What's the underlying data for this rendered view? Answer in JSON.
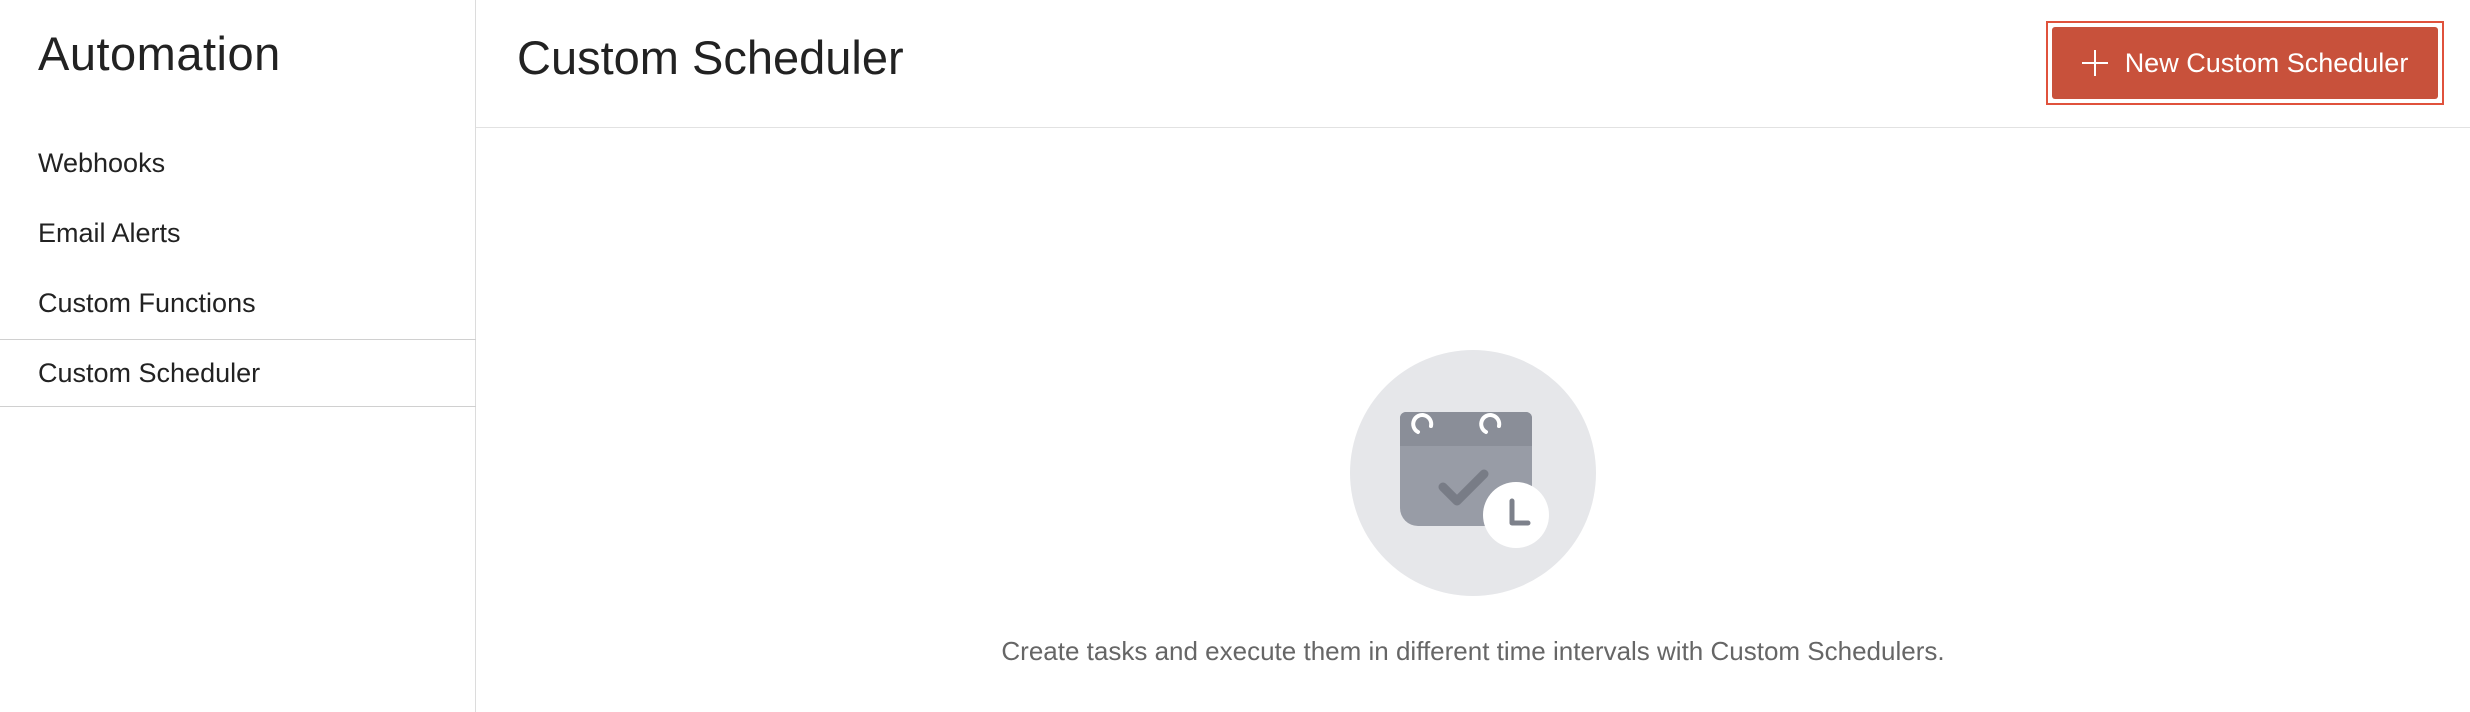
{
  "sidebar": {
    "title": "Automation",
    "items": [
      {
        "label": "Webhooks",
        "active": false
      },
      {
        "label": "Email Alerts",
        "active": false
      },
      {
        "label": "Custom Functions",
        "active": false
      },
      {
        "label": "Custom Scheduler",
        "active": true
      }
    ]
  },
  "header": {
    "title": "Custom Scheduler",
    "new_button_label": "New Custom Scheduler",
    "new_button_icon": "plus-icon",
    "accent_color": "#c8513b"
  },
  "empty_state": {
    "illustration_icon": "calendar-clock-icon",
    "message": "Create tasks and execute them in different time intervals with Custom Schedulers."
  }
}
